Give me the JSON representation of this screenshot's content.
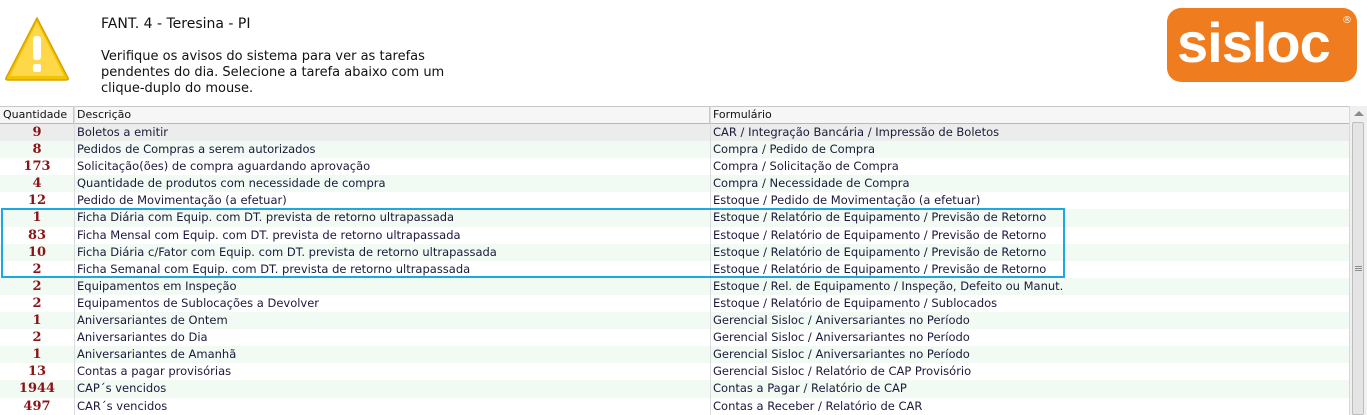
{
  "header": {
    "title": "FANT. 4 - Teresina - PI",
    "message": "Verifique os avisos do sistema para ver as tarefas pendentes do dia. Selecione a tarefa abaixo com um clique-duplo do mouse.",
    "logo_text": "sisloc",
    "logo_color": "#ef7d1f",
    "warning_icon": "warning-triangle-icon"
  },
  "table": {
    "columns": [
      "Quantidade",
      "Descrição",
      "Formulário"
    ],
    "rows": [
      {
        "qty": "9",
        "desc": "Boletos a emitir",
        "form": "CAR / Integração Bancária / Impressão de Boletos"
      },
      {
        "qty": "8",
        "desc": "Pedidos de Compras a serem autorizados",
        "form": "Compra / Pedido de Compra"
      },
      {
        "qty": "173",
        "desc": "Solicitação(ões) de compra aguardando aprovação",
        "form": "Compra / Solicitação de Compra"
      },
      {
        "qty": "4",
        "desc": "Quantidade de produtos com necessidade de compra",
        "form": "Compra / Necessidade de Compra"
      },
      {
        "qty": "12",
        "desc": "Pedido de Movimentação (a efetuar)",
        "form": "Estoque / Pedido de Movimentação (a efetuar)"
      },
      {
        "qty": "1",
        "desc": "Ficha Diária com Equip. com DT. prevista de retorno ultrapassada",
        "form": "Estoque / Relatório de Equipamento / Previsão de Retorno"
      },
      {
        "qty": "83",
        "desc": "Ficha Mensal com Equip. com DT. prevista de retorno ultrapassada",
        "form": "Estoque / Relatório de Equipamento / Previsão de Retorno"
      },
      {
        "qty": "10",
        "desc": "Ficha Diária c/Fator com Equip. com DT. prevista de retorno ultrapassada",
        "form": "Estoque / Relatório de Equipamento / Previsão de Retorno"
      },
      {
        "qty": "2",
        "desc": "Ficha Semanal com Equip. com DT. prevista de retorno ultrapassada",
        "form": "Estoque / Relatório de Equipamento / Previsão de Retorno"
      },
      {
        "qty": "2",
        "desc": "Equipamentos em Inspeção",
        "form": "Estoque / Rel. de Equipamento / Inspeção, Defeito ou Manut."
      },
      {
        "qty": "2",
        "desc": "Equipamentos de Sublocações a Devolver",
        "form": "Estoque / Relatório de Equipamento / Sublocados"
      },
      {
        "qty": "1",
        "desc": "Aniversariantes de Ontem",
        "form": "Gerencial Sisloc / Aniversariantes no Período"
      },
      {
        "qty": "2",
        "desc": "Aniversariantes do Dia",
        "form": "Gerencial Sisloc / Aniversariantes no Período"
      },
      {
        "qty": "1",
        "desc": "Aniversariantes de Amanhã",
        "form": "Gerencial Sisloc / Aniversariantes no Período"
      },
      {
        "qty": "13",
        "desc": "Contas a pagar provisórias",
        "form": "Gerencial Sisloc / Relatório de CAP Provisório"
      },
      {
        "qty": "1944",
        "desc": "CAP´s vencidos",
        "form": "Contas a Pagar / Relatório de CAP"
      },
      {
        "qty": "497",
        "desc": "CAR´s vencidos",
        "form": "Contas a Receber / Relatório de CAR"
      }
    ],
    "highlight_color": "#1ea7e1",
    "quantity_color": "#8a1418"
  }
}
